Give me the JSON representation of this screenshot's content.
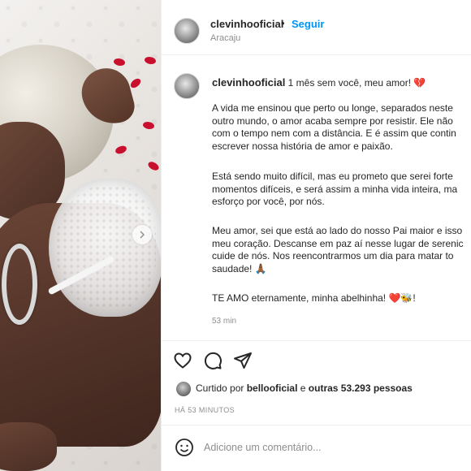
{
  "post": {
    "username": "clevinhooficial",
    "separator": "•",
    "follow_label": "Seguir",
    "location": "Aracaju"
  },
  "caption": {
    "username": "clevinhooficial",
    "first_line": "1 mês sem você, meu amor! 💔",
    "paragraph_1": "A vida me ensinou que perto ou longe, separados neste\noutro mundo, o amor acaba sempre por resistir. Ele não\ncom o tempo nem com a distância. E é assim que contin\nescrever nossa história de amor e paixão.",
    "paragraph_2": "Está sendo muito difícil, mas eu prometo que serei forte\nmomentos difíceis, e será assim a minha vida inteira, ma\nesforço por você, por nós.",
    "paragraph_3": "Meu amor, sei que está ao lado do nosso Pai maior e isso\nmeu coração. Descanse em paz aí nesse lugar de serenic\ncuide de nós. Nos reencontrarmos um dia para matar to\nsaudade! 🙏🏾",
    "paragraph_4": "TE AMO eternamente, minha abelhinha! ❤️🐝!",
    "time": "53 min"
  },
  "likes": {
    "prefix": "Curtido por",
    "user": "bellooficial",
    "connector": "e",
    "others": "outras 53.293 pessoas"
  },
  "timestamp": "HÁ 53 MINUTOS",
  "comment": {
    "placeholder": "Adicione um comentário..."
  },
  "icons": {
    "like": "heart-icon",
    "comment": "comment-icon",
    "share": "share-icon",
    "emoji": "emoji-icon",
    "next": "chevron-right-icon"
  },
  "colors": {
    "accent": "#0095f6",
    "muted": "#8e8e8e",
    "text": "#262626",
    "petal": "#c8102e"
  }
}
